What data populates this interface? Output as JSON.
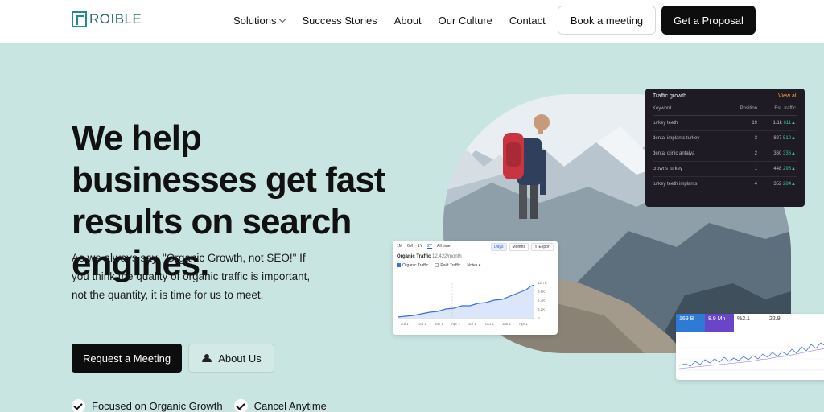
{
  "header": {
    "logo_text": "ROIBLE",
    "nav": [
      "Solutions",
      "Success Stories",
      "About",
      "Our Culture",
      "Contact"
    ],
    "book_meeting": "Book a meeting",
    "get_proposal": "Get a Proposal"
  },
  "hero": {
    "title": "We help businesses get fast results on search engines.",
    "subtitle": "As we always say, \"Organic Growth, not SEO!\" If you think the quality of organic traffic is important, not the quantity, it is time for us to meet.",
    "request_meeting": "Request a Meeting",
    "about_us": "About Us",
    "features": [
      "Focused on Organic Growth",
      "Cancel Anytime"
    ]
  },
  "keyword_card": {
    "title": "Traffic growth",
    "view_all": "View all",
    "columns": [
      "Keyword",
      "Position",
      "Est. traffic"
    ],
    "rows": [
      {
        "keyword": "turkey teeth",
        "position": "19",
        "traffic": "1.1k",
        "change": "611"
      },
      {
        "keyword": "dental implants turkey",
        "position": "3",
        "traffic": "827",
        "change": "510"
      },
      {
        "keyword": "dental clinic antalya",
        "position": "2",
        "traffic": "360",
        "change": "336"
      },
      {
        "keyword": "crowns turkey",
        "position": "1",
        "traffic": "448",
        "change": "296"
      },
      {
        "keyword": "turkey teeth implants",
        "position": "4",
        "traffic": "352",
        "change": "284"
      }
    ]
  },
  "organic_card": {
    "ranges": [
      "1M",
      "6M",
      "1Y",
      "2Y",
      "All time"
    ],
    "toggle": [
      "Days",
      "Months"
    ],
    "export": "Export",
    "title": "Organic Traffic",
    "value": "12,422/month",
    "legend": [
      "Organic Traffic",
      "Paid Traffic",
      "Notes"
    ],
    "y_ticks": [
      "12.7K",
      "9.6K",
      "6.4K",
      "3.2K",
      "0"
    ],
    "x_ticks": [
      "Jul 1",
      "Oct 1",
      "Jan 1",
      "Apr 1",
      "Jul 1",
      "Oct 1",
      "Jan 1",
      "Apr 1"
    ]
  },
  "metrics_card": {
    "tiles": [
      "169 B",
      "8.9 Mn",
      "%2.1",
      "22.9"
    ]
  },
  "colors": {
    "background": "#c9e5e2",
    "accent": "#1f8b8a",
    "dark": "#0d0d0d"
  }
}
